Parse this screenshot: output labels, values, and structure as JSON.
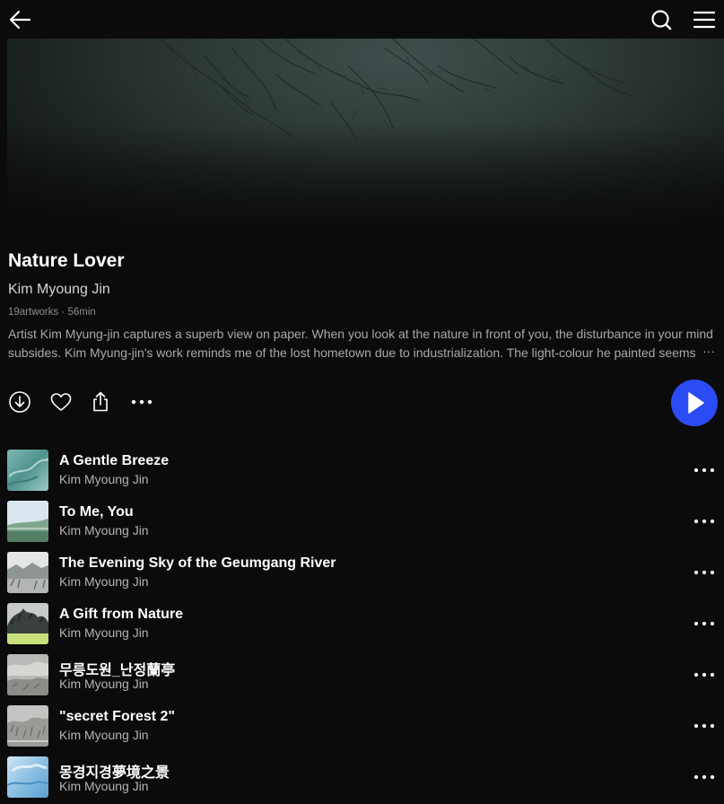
{
  "header": {
    "back_icon": "arrow-left-icon",
    "search_icon": "search-icon",
    "menu_icon": "hamburger-menu-icon"
  },
  "playlist": {
    "title": "Nature Lover",
    "artist": "Kim Myoung Jin",
    "meta": "19artworks · 56min",
    "description": "Artist Kim Myung-jin captures a superb view on paper. When you look at the nature in front of you, the disturbance in your mind subsides. Kim Myung-jin's work reminds me of the lost hometown due to industrialization. The light-colour he painted seems",
    "description_more": "···"
  },
  "actions": {
    "download_icon": "download-icon",
    "like_icon": "heart-icon",
    "share_icon": "share-icon",
    "more_icon": "more-horizontal-icon",
    "play_icon": "play-icon",
    "play_color": "#2b4bf5"
  },
  "tracks": [
    {
      "title": "A Gentle Breeze",
      "artist": "Kim Myoung Jin"
    },
    {
      "title": "To Me, You",
      "artist": "Kim Myoung Jin"
    },
    {
      "title": "The Evening Sky of the Geumgang River",
      "artist": "Kim Myoung Jin"
    },
    {
      "title": "A Gift from Nature",
      "artist": "Kim Myoung Jin"
    },
    {
      "title": "무릉도원_난정蘭亭",
      "artist": "Kim Myoung Jin"
    },
    {
      "title": "\"secret Forest 2\"",
      "artist": "Kim Myoung Jin"
    },
    {
      "title": "몽경지경夢境之景",
      "artist": "Kim Myoung Jin"
    }
  ]
}
